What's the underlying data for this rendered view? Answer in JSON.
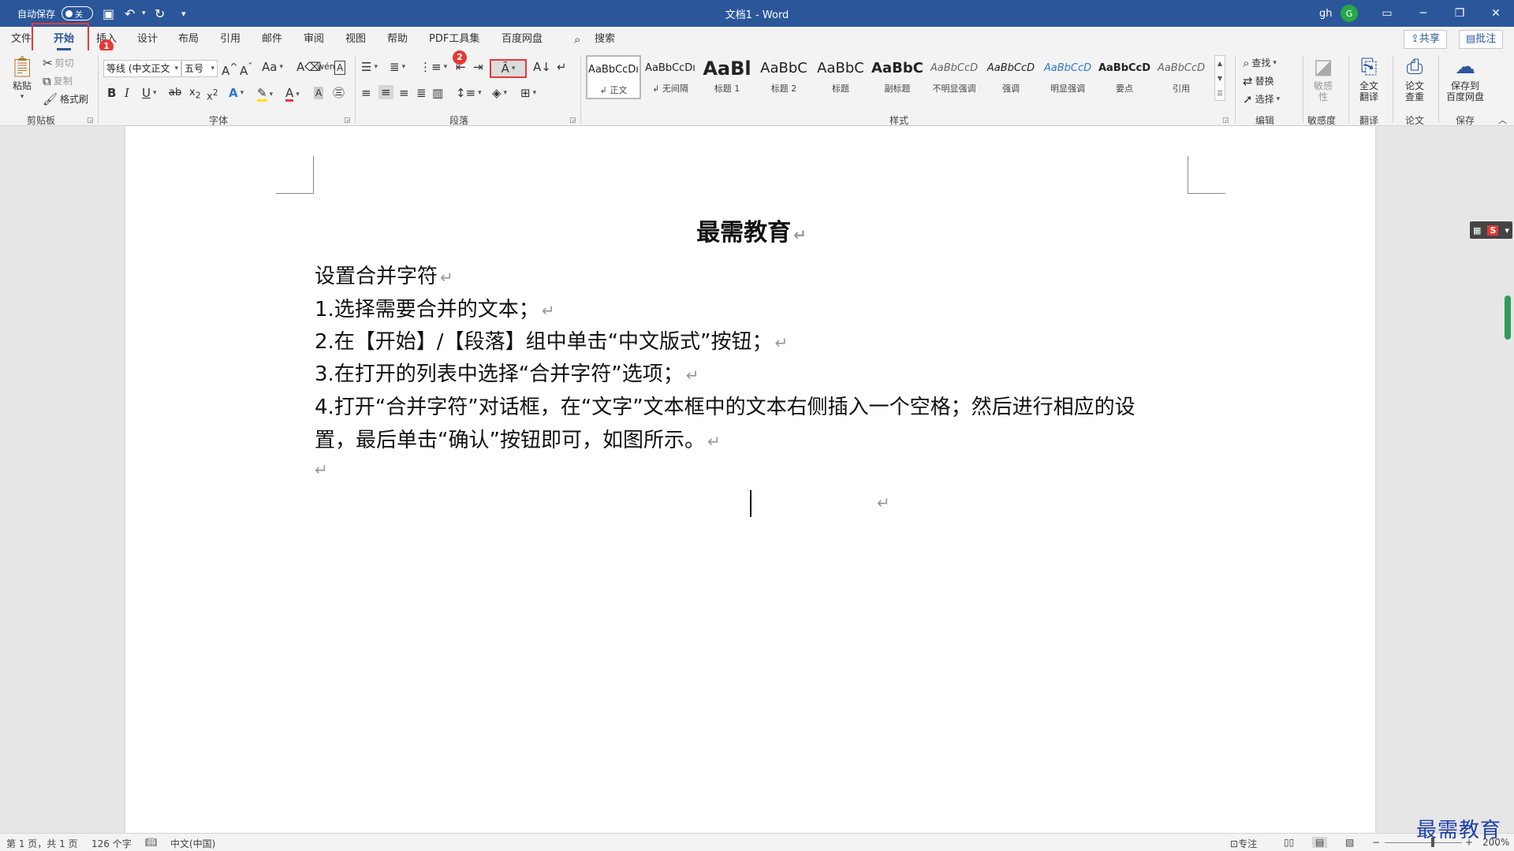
{
  "titlebar": {
    "autosave_label": "自动保存",
    "autosave_state": "关",
    "doc_title": "文档1  -  Word",
    "user_name": "gh",
    "user_initial": "G"
  },
  "tabs": [
    "文件",
    "开始",
    "插入",
    "设计",
    "布局",
    "引用",
    "邮件",
    "审阅",
    "视图",
    "帮助",
    "PDF工具集",
    "百度网盘"
  ],
  "search_label": "搜索",
  "share_label": "共享",
  "comment_label": "批注",
  "badges": {
    "one": "1",
    "two": "2"
  },
  "clipboard": {
    "paste": "粘贴",
    "cut": "剪切",
    "copy": "复制",
    "format_painter": "格式刷",
    "group": "剪贴板"
  },
  "font": {
    "name": "等线 (中文正文",
    "size": "五号",
    "group": "字体"
  },
  "paragraph": {
    "group": "段落"
  },
  "styles": {
    "group": "样式",
    "items": [
      {
        "preview": "AaBbCcDı",
        "name": "↲ 正文"
      },
      {
        "preview": "AaBbCcDı",
        "name": "↲ 无间隔"
      },
      {
        "preview": "AaBl",
        "name": "标题 1"
      },
      {
        "preview": "AaBbC",
        "name": "标题 2"
      },
      {
        "preview": "AaBbC",
        "name": "标题"
      },
      {
        "preview": "AaBbC",
        "name": "副标题"
      },
      {
        "preview": "AaBbCcD",
        "name": "不明显强调"
      },
      {
        "preview": "AaBbCcD",
        "name": "强调"
      },
      {
        "preview": "AaBbCcD",
        "name": "明显强调"
      },
      {
        "preview": "AaBbCcD",
        "name": "要点"
      },
      {
        "preview": "AaBbCcD",
        "name": "引用"
      }
    ]
  },
  "editing": {
    "find": "查找",
    "replace": "替换",
    "select": "选择",
    "group": "编辑"
  },
  "sensitivity": {
    "button": "敏感性",
    "group": "敏感度"
  },
  "translate": {
    "button_line1": "全文",
    "button_line2": "翻译",
    "group": "翻译"
  },
  "paper": {
    "button_line1": "论文",
    "button_line2": "查重",
    "group": "论文"
  },
  "save": {
    "button_line1": "保存到",
    "button_line2": "百度网盘",
    "group": "保存"
  },
  "document": {
    "title": "最需教育",
    "lines": [
      "设置合并字符",
      "1.选择需要合并的文本；",
      "2.在【开始】/【段落】组中单击“中文版式”按钮；",
      "3.在打开的列表中选择“合并字符”选项；",
      "4.打开“合并字符”对话框，在“文字”文本框中的文本右侧插入一个空格；然后进行相应的设",
      "置，最后单击“确认”按钮即可，如图所示。"
    ],
    "paragraph_mark": "↵"
  },
  "status": {
    "page": "第 1 页，共 1 页",
    "words": "126 个字",
    "language": "中文(中国)",
    "focus": "专注",
    "zoom": "200%"
  },
  "watermark": "最需教育"
}
